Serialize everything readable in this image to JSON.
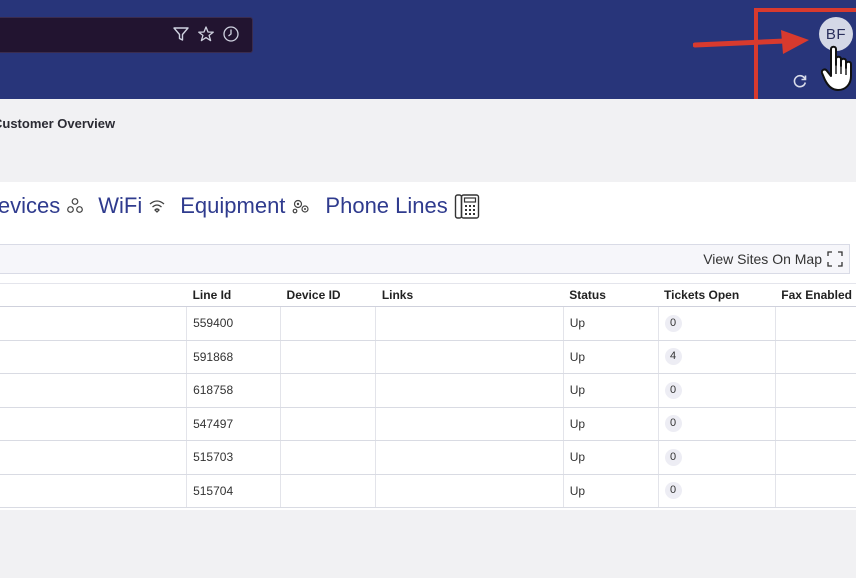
{
  "header": {
    "avatar_initials": "BF"
  },
  "breadcrumb": {
    "label": "Customer Overview"
  },
  "tabs": [
    {
      "label": "Devices",
      "icon": "devices-icon"
    },
    {
      "label": "WiFi",
      "icon": "wifi-icon"
    },
    {
      "label": "Equipment",
      "icon": "equipment-icon"
    },
    {
      "label": "Phone Lines",
      "icon": "phone-lines-icon"
    }
  ],
  "map": {
    "view_sites_label": "View Sites On Map"
  },
  "table": {
    "columns": [
      "",
      "Line Id",
      "Device ID",
      "Links",
      "Status",
      "Tickets Open",
      "Fax Enabled"
    ],
    "rows": [
      {
        "line_id": "559400",
        "device_id": "",
        "links": "",
        "status": "Up",
        "tickets": "0",
        "fax": ""
      },
      {
        "line_id": "591868",
        "device_id": "",
        "links": "",
        "status": "Up",
        "tickets": "4",
        "fax": ""
      },
      {
        "line_id": "618758",
        "device_id": "",
        "links": "",
        "status": "Up",
        "tickets": "0",
        "fax": ""
      },
      {
        "line_id": "547497",
        "device_id": "",
        "links": "",
        "status": "Up",
        "tickets": "0",
        "fax": ""
      },
      {
        "line_id": "515703",
        "device_id": "",
        "links": "",
        "status": "Up",
        "tickets": "0",
        "fax": ""
      },
      {
        "line_id": "515704",
        "device_id": "",
        "links": "",
        "status": "Up",
        "tickets": "0",
        "fax": ""
      }
    ]
  },
  "colors": {
    "header_bg": "#28357a",
    "accent_text": "#2f3b8e",
    "annotation_red": "#d83a2e"
  }
}
